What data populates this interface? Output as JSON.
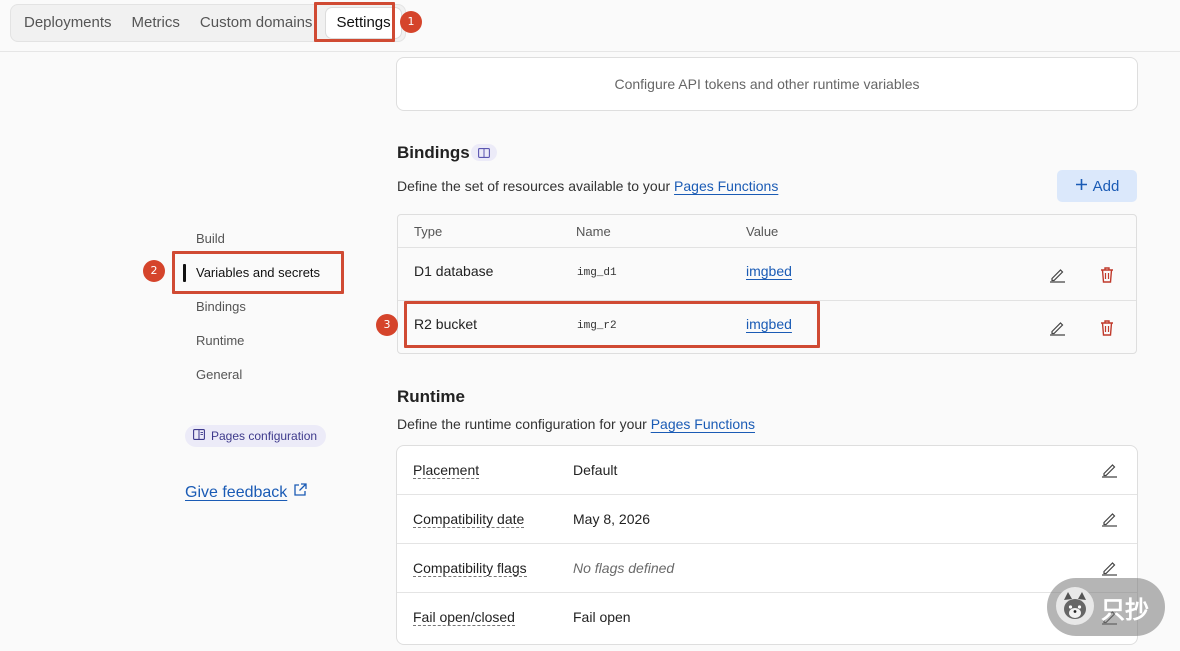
{
  "tabs": [
    {
      "label": "Deployments"
    },
    {
      "label": "Metrics"
    },
    {
      "label": "Custom domains"
    },
    {
      "label": "Settings",
      "active": true
    }
  ],
  "annotations": {
    "one": "1",
    "two": "2",
    "three": "3"
  },
  "sidebar": {
    "items": [
      {
        "label": "Build"
      },
      {
        "label": "Variables and secrets",
        "active": true
      },
      {
        "label": "Bindings"
      },
      {
        "label": "Runtime"
      },
      {
        "label": "General"
      }
    ],
    "pages_config_label": "Pages configuration",
    "feedback_label": "Give feedback"
  },
  "env": {
    "description": "Configure API tokens and other runtime variables"
  },
  "bindings": {
    "title": "Bindings",
    "description_prefix": "Define the set of resources available to your ",
    "description_link": "Pages Functions",
    "add_label": "Add",
    "columns": [
      "Type",
      "Name",
      "Value"
    ],
    "rows": [
      {
        "type": "D1 database",
        "name": "img_d1",
        "value": "imgbed"
      },
      {
        "type": "R2 bucket",
        "name": "img_r2",
        "value": "imgbed"
      }
    ]
  },
  "runtime": {
    "title": "Runtime",
    "description_prefix": "Define the runtime configuration for your ",
    "description_link": "Pages Functions",
    "rows": [
      {
        "label": "Placement",
        "value": "Default",
        "muted": false
      },
      {
        "label": "Compatibility date",
        "value": "May 8, 2026",
        "muted": false
      },
      {
        "label": "Compatibility flags",
        "value": "No flags defined",
        "muted": true
      },
      {
        "label": "Fail open/closed",
        "value": "Fail open",
        "muted": false
      }
    ]
  },
  "watermark": {
    "text": "只抄"
  },
  "colors": {
    "accent": "#1a5bb5",
    "annotation": "#d5442b",
    "danger": "#c0392b"
  }
}
